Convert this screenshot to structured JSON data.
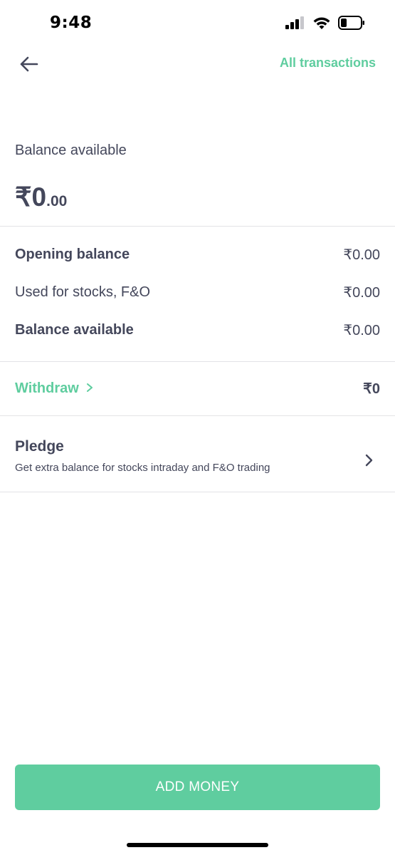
{
  "status_bar": {
    "time": "9:48",
    "icons": [
      "signal-icon",
      "wifi-icon",
      "battery-icon"
    ]
  },
  "header": {
    "back_icon": "arrow-left-icon",
    "all_transactions_label": "All transactions"
  },
  "balance": {
    "label": "Balance available",
    "amount_main": "₹0",
    "amount_decimal": ".00"
  },
  "summary": {
    "rows": [
      {
        "label": "Opening balance",
        "value": "₹0.00"
      },
      {
        "label": "Used for stocks, F&O",
        "value": "₹0.00"
      },
      {
        "label": "Balance available",
        "value": "₹0.00"
      }
    ]
  },
  "withdraw": {
    "label": "Withdraw",
    "icon": "chevron-right-icon",
    "amount": "₹0"
  },
  "pledge": {
    "title": "Pledge",
    "subtitle": "Get extra balance for stocks intraday and F&O trading",
    "icon": "chevron-right-icon"
  },
  "footer": {
    "add_money_label": "ADD MONEY"
  },
  "colors": {
    "accent": "#5fcd9f",
    "text": "#44475b",
    "divider": "#e3e3e6"
  }
}
